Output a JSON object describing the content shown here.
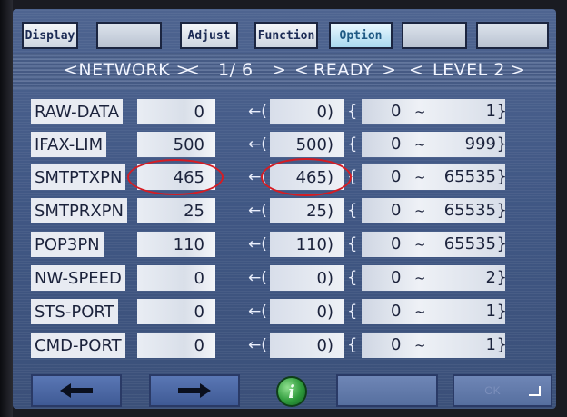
{
  "tabs": [
    {
      "label": "Display"
    },
    {
      "label": ""
    },
    {
      "label": "Adjust"
    },
    {
      "label": "Function"
    },
    {
      "label": "Option"
    },
    {
      "label": ""
    },
    {
      "label": ""
    }
  ],
  "status": {
    "group": "<NETWORK >",
    "page_prev": "<",
    "page": "1/ 6",
    "page_next": ">",
    "ready_open": "<",
    "ready": "READY",
    "ready_close": ">",
    "level_open": "<",
    "level": "LEVEL 2",
    "level_close": ">"
  },
  "params": [
    {
      "name": "RAW-DATA",
      "value": "0",
      "arrow": "←(",
      "default": "0)",
      "lbrace": "{",
      "min": "0",
      "tilde": "~",
      "max": "1",
      "rbrace": "}"
    },
    {
      "name": "IFAX-LIM",
      "value": "500",
      "arrow": "←(",
      "default": "500)",
      "lbrace": "{",
      "min": "0",
      "tilde": "~",
      "max": "999",
      "rbrace": "}"
    },
    {
      "name": "SMTPTXPN",
      "value": "465",
      "arrow": "←(",
      "default": "465)",
      "lbrace": "{",
      "min": "0",
      "tilde": "~",
      "max": "65535",
      "rbrace": "}"
    },
    {
      "name": "SMTPRXPN",
      "value": "25",
      "arrow": "←(",
      "default": "25)",
      "lbrace": "{",
      "min": "0",
      "tilde": "~",
      "max": "65535",
      "rbrace": "}"
    },
    {
      "name": "POP3PN",
      "value": "110",
      "arrow": "←(",
      "default": "110)",
      "lbrace": "{",
      "min": "0",
      "tilde": "~",
      "max": "65535",
      "rbrace": "}"
    },
    {
      "name": "NW-SPEED",
      "value": "0",
      "arrow": "←(",
      "default": "0)",
      "lbrace": "{",
      "min": "0",
      "tilde": "~",
      "max": "2",
      "rbrace": "}"
    },
    {
      "name": "STS-PORT",
      "value": "0",
      "arrow": "←(",
      "default": "0)",
      "lbrace": "{",
      "min": "0",
      "tilde": "~",
      "max": "1",
      "rbrace": "}"
    },
    {
      "name": "CMD-PORT",
      "value": "0",
      "arrow": "←(",
      "default": "0)",
      "lbrace": "{",
      "min": "0",
      "tilde": "~",
      "max": "1",
      "rbrace": "}"
    }
  ],
  "bottom": {
    "back_icon": "left-arrow-icon",
    "next_icon": "right-arrow-icon",
    "info_glyph": "i",
    "ok_label": "OK",
    "enter_icon": "enter-icon"
  },
  "colors": {
    "highlight_circle": "#d51c23",
    "screen_bg": "#405784",
    "info_button": "#2e9a3b"
  }
}
